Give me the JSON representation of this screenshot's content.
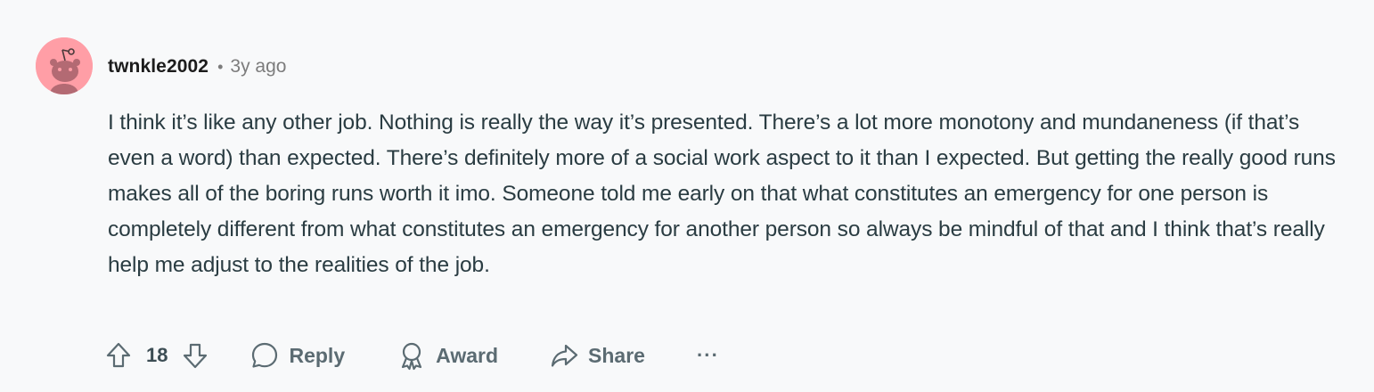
{
  "comment": {
    "username": "twnkle2002",
    "separator": "•",
    "time_ago": "3y ago",
    "body": "I think it’s like any other job. Nothing is really the way it’s presented. There’s a lot more monotony and mundaneness (if that’s even a word) than expected. There’s definitely more of a social work aspect to it than I expected. But getting the really good runs makes all of the boring runs worth it imo. Someone told me early on that what constitutes an emergency for one person is completely different from what constitutes an emergency for another person so always be mindful of that and I think that’s really help me adjust to the realities of the job.",
    "avatar_color": "#ff9ea6"
  },
  "actions": {
    "vote_count": "18",
    "reply_label": "Reply",
    "award_label": "Award",
    "share_label": "Share",
    "more_label": "···"
  },
  "icons": {
    "upvote": "upvote-arrow-icon",
    "downvote": "downvote-arrow-icon",
    "reply": "speech-bubble-icon",
    "award": "award-ribbon-icon",
    "share": "share-arrow-icon",
    "more": "ellipsis-icon"
  }
}
